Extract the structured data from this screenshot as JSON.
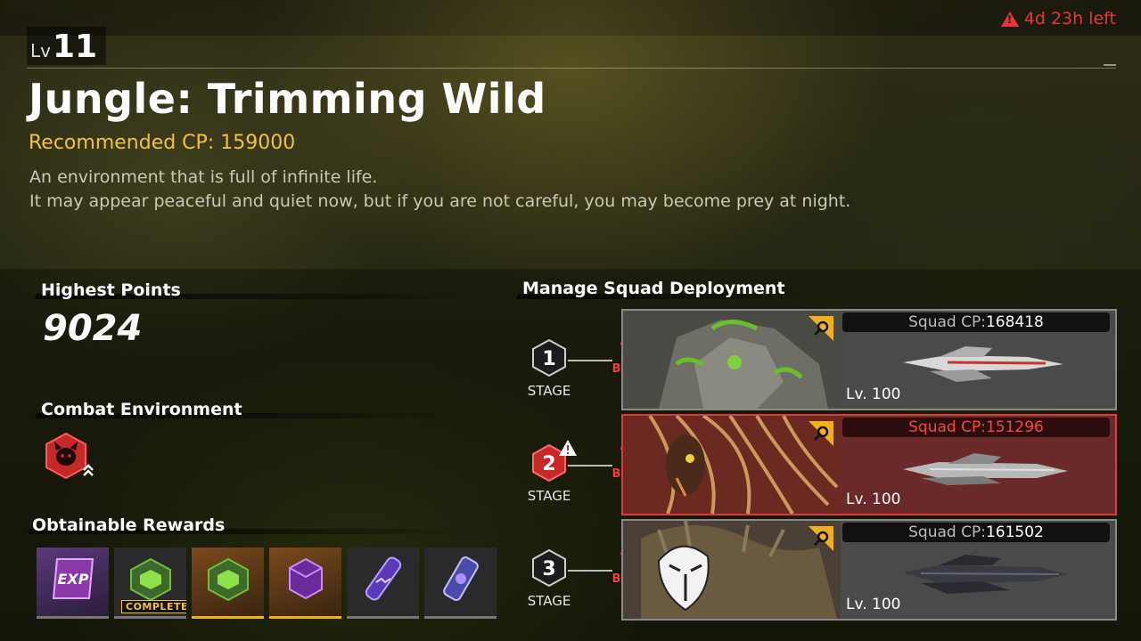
{
  "timer": {
    "text": "4d 23h left"
  },
  "level": {
    "label": "Lv",
    "value": "11"
  },
  "title": "Jungle: Trimming Wild",
  "recommended": "Recommended CP: 159000",
  "description": {
    "line1": "An environment that is full of infinite life.",
    "line2": "It may appear peaceful and quiet now, but if you are not careful, you may become prey at night."
  },
  "highest_points": {
    "label": "Highest Points",
    "value": "9024"
  },
  "combat_environment": {
    "label": "Combat Environment"
  },
  "rewards": {
    "label": "Obtainable Rewards",
    "items": [
      {
        "icon": "exp-card-icon",
        "text": "EXP"
      },
      {
        "icon": "green-crate-icon",
        "badge": "COMPLETE"
      },
      {
        "icon": "green-crate-icon"
      },
      {
        "icon": "purple-box-icon"
      },
      {
        "icon": "purple-capsule-icon"
      },
      {
        "icon": "purple-canister-icon"
      }
    ]
  },
  "squad": {
    "label": "Manage Squad Deployment",
    "boss_label": "BOSS",
    "stages": [
      {
        "number": "1",
        "label": "STAGE",
        "cp_label": "Squad CP:",
        "cp": "168418",
        "level": "Lv. 100"
      },
      {
        "number": "2",
        "label": "STAGE",
        "cp_label": "Squad CP:",
        "cp": "151296",
        "level": "Lv. 100"
      },
      {
        "number": "3",
        "label": "STAGE",
        "cp_label": "Squad CP:",
        "cp": "161502",
        "level": "Lv. 100"
      }
    ]
  },
  "colors": {
    "accent_gold": "#f2c23a",
    "alert_red": "#e8353b"
  }
}
